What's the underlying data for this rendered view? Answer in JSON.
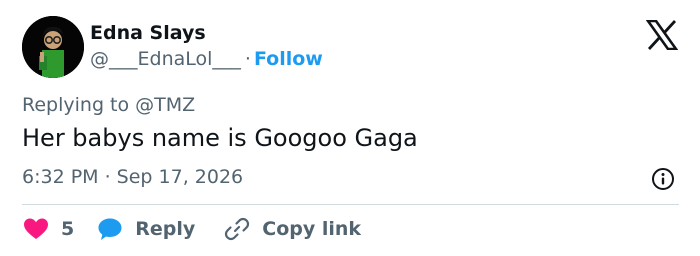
{
  "author": {
    "display_name": "Edna Slays",
    "handle": "@___EdnaLol___",
    "separator": "·",
    "follow_label": "Follow",
    "avatar": "edna-mode-avatar"
  },
  "brand_icon": "x-logo-icon",
  "replying_to": "Replying to @TMZ",
  "tweet_text": "Her babys name is Googoo Gaga",
  "timestamp": "6:32 PM · Sep 17, 2026",
  "info_icon": "info-icon",
  "actions": {
    "likes": {
      "icon": "heart-icon",
      "count": "5"
    },
    "reply": {
      "icon": "speech-bubble-icon",
      "label": "Reply"
    },
    "copy": {
      "icon": "link-icon",
      "label": "Copy link"
    }
  },
  "colors": {
    "accent": "#1d9bf0",
    "heart": "#f91880",
    "text_primary": "#0f1419",
    "text_secondary": "#536471",
    "divider": "#cfd9de"
  }
}
